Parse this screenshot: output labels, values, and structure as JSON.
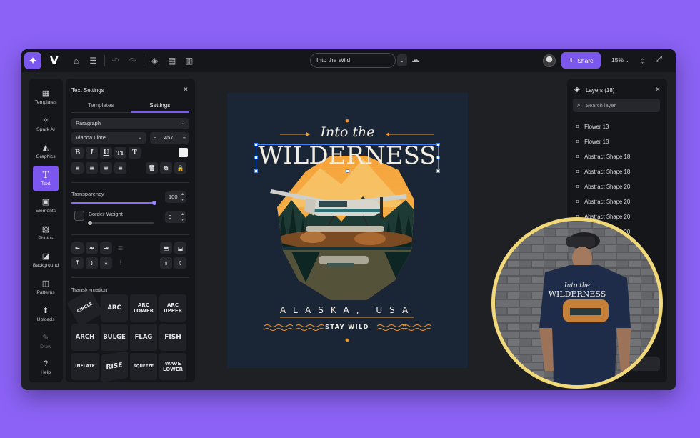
{
  "topbar": {
    "logo_glyph": "✦",
    "brand_letter": "V",
    "doc_title": "Into the Wild",
    "share_label": "Share",
    "zoom": "15%"
  },
  "rail": [
    {
      "label": "Templates",
      "icon": "templates-icon",
      "glyph": "▦"
    },
    {
      "label": "Spark AI",
      "icon": "spark-icon",
      "glyph": "✧"
    },
    {
      "label": "Graphics",
      "icon": "graphics-icon",
      "glyph": "◭"
    },
    {
      "label": "Text",
      "icon": "text-icon",
      "glyph": "T"
    },
    {
      "label": "Elements",
      "icon": "elements-icon",
      "glyph": "▣"
    },
    {
      "label": "Photos",
      "icon": "photos-icon",
      "glyph": "▨"
    },
    {
      "label": "Background",
      "icon": "background-icon",
      "glyph": "◪"
    },
    {
      "label": "Patterns",
      "icon": "patterns-icon",
      "glyph": "◫"
    },
    {
      "label": "Uploads",
      "icon": "uploads-icon",
      "glyph": "⬆"
    },
    {
      "label": "Draw",
      "icon": "draw-icon",
      "glyph": "✎"
    },
    {
      "label": "Help",
      "icon": "help-icon",
      "glyph": "?"
    }
  ],
  "text_settings": {
    "title": "Text Settings",
    "close": "×",
    "tabs": [
      "Templates",
      "Settings"
    ],
    "style": "Paragraph",
    "font": "Viaoda Libre",
    "font_size": "457",
    "minus": "−",
    "plus": "+",
    "format_buttons": [
      "B",
      "I",
      "U",
      "TT",
      "T"
    ],
    "transparency_label": "Transparency",
    "transparency_value": "100",
    "transparency_level": 1.0,
    "border_weight_label": "Border Weight",
    "border_weight_value": "0",
    "transformation_label": "Transformation",
    "transforms": [
      "CIRCLE",
      "ARC",
      "ARC LOWER",
      "ARC UPPER",
      "ARCH",
      "BULGE",
      "FLAG",
      "FISH",
      "INFLATE",
      "RISE",
      "SQUEEZE",
      "WAVE LOWER"
    ]
  },
  "design": {
    "line1": "Into the",
    "line2": "WILDERNESS",
    "line3": "ALASKA, USA",
    "line4": "STAY WILD"
  },
  "layers": {
    "title": "Layers (18)",
    "close": "×",
    "search_placeholder": "Search layer",
    "items": [
      "Flower 13",
      "Flower 13",
      "Abstract Shape 18",
      "Abstract Shape 18",
      "Abstract Shape 20",
      "Abstract Shape 20",
      "Abstract Shape 20",
      "Abstract Shape 20"
    ]
  },
  "photo": {
    "shirt_line1": "Into the",
    "shirt_line2": "WILDERNESS"
  },
  "colors": {
    "accent": "#7b57ee",
    "background": "#8b62f5",
    "artboard": "#1a2536",
    "orange": "#f29a2e",
    "frame": "#f1d879"
  }
}
